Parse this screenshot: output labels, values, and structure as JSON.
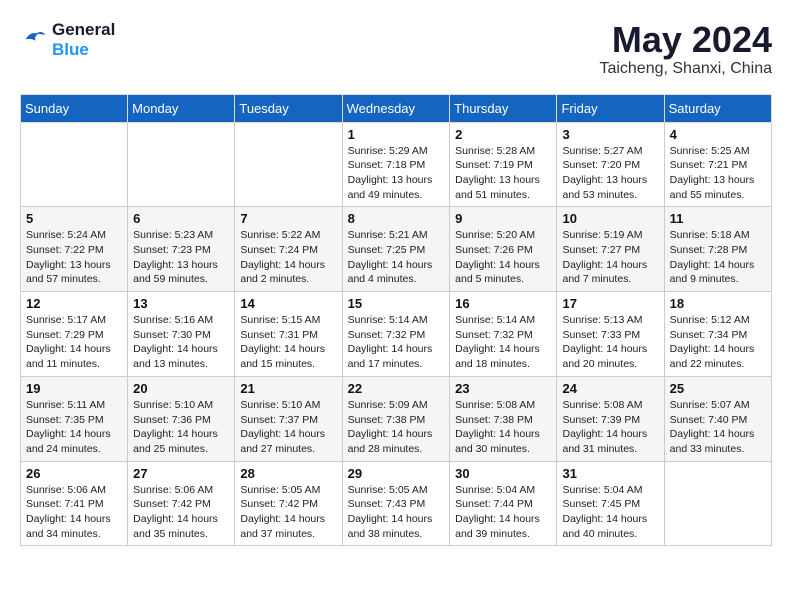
{
  "header": {
    "logo_line1": "General",
    "logo_line2": "Blue",
    "month": "May 2024",
    "location": "Taicheng, Shanxi, China"
  },
  "weekdays": [
    "Sunday",
    "Monday",
    "Tuesday",
    "Wednesday",
    "Thursday",
    "Friday",
    "Saturday"
  ],
  "weeks": [
    [
      {
        "day": "",
        "info": ""
      },
      {
        "day": "",
        "info": ""
      },
      {
        "day": "",
        "info": ""
      },
      {
        "day": "1",
        "info": "Sunrise: 5:29 AM\nSunset: 7:18 PM\nDaylight: 13 hours\nand 49 minutes."
      },
      {
        "day": "2",
        "info": "Sunrise: 5:28 AM\nSunset: 7:19 PM\nDaylight: 13 hours\nand 51 minutes."
      },
      {
        "day": "3",
        "info": "Sunrise: 5:27 AM\nSunset: 7:20 PM\nDaylight: 13 hours\nand 53 minutes."
      },
      {
        "day": "4",
        "info": "Sunrise: 5:25 AM\nSunset: 7:21 PM\nDaylight: 13 hours\nand 55 minutes."
      }
    ],
    [
      {
        "day": "5",
        "info": "Sunrise: 5:24 AM\nSunset: 7:22 PM\nDaylight: 13 hours\nand 57 minutes."
      },
      {
        "day": "6",
        "info": "Sunrise: 5:23 AM\nSunset: 7:23 PM\nDaylight: 13 hours\nand 59 minutes."
      },
      {
        "day": "7",
        "info": "Sunrise: 5:22 AM\nSunset: 7:24 PM\nDaylight: 14 hours\nand 2 minutes."
      },
      {
        "day": "8",
        "info": "Sunrise: 5:21 AM\nSunset: 7:25 PM\nDaylight: 14 hours\nand 4 minutes."
      },
      {
        "day": "9",
        "info": "Sunrise: 5:20 AM\nSunset: 7:26 PM\nDaylight: 14 hours\nand 5 minutes."
      },
      {
        "day": "10",
        "info": "Sunrise: 5:19 AM\nSunset: 7:27 PM\nDaylight: 14 hours\nand 7 minutes."
      },
      {
        "day": "11",
        "info": "Sunrise: 5:18 AM\nSunset: 7:28 PM\nDaylight: 14 hours\nand 9 minutes."
      }
    ],
    [
      {
        "day": "12",
        "info": "Sunrise: 5:17 AM\nSunset: 7:29 PM\nDaylight: 14 hours\nand 11 minutes."
      },
      {
        "day": "13",
        "info": "Sunrise: 5:16 AM\nSunset: 7:30 PM\nDaylight: 14 hours\nand 13 minutes."
      },
      {
        "day": "14",
        "info": "Sunrise: 5:15 AM\nSunset: 7:31 PM\nDaylight: 14 hours\nand 15 minutes."
      },
      {
        "day": "15",
        "info": "Sunrise: 5:14 AM\nSunset: 7:32 PM\nDaylight: 14 hours\nand 17 minutes."
      },
      {
        "day": "16",
        "info": "Sunrise: 5:14 AM\nSunset: 7:32 PM\nDaylight: 14 hours\nand 18 minutes."
      },
      {
        "day": "17",
        "info": "Sunrise: 5:13 AM\nSunset: 7:33 PM\nDaylight: 14 hours\nand 20 minutes."
      },
      {
        "day": "18",
        "info": "Sunrise: 5:12 AM\nSunset: 7:34 PM\nDaylight: 14 hours\nand 22 minutes."
      }
    ],
    [
      {
        "day": "19",
        "info": "Sunrise: 5:11 AM\nSunset: 7:35 PM\nDaylight: 14 hours\nand 24 minutes."
      },
      {
        "day": "20",
        "info": "Sunrise: 5:10 AM\nSunset: 7:36 PM\nDaylight: 14 hours\nand 25 minutes."
      },
      {
        "day": "21",
        "info": "Sunrise: 5:10 AM\nSunset: 7:37 PM\nDaylight: 14 hours\nand 27 minutes."
      },
      {
        "day": "22",
        "info": "Sunrise: 5:09 AM\nSunset: 7:38 PM\nDaylight: 14 hours\nand 28 minutes."
      },
      {
        "day": "23",
        "info": "Sunrise: 5:08 AM\nSunset: 7:38 PM\nDaylight: 14 hours\nand 30 minutes."
      },
      {
        "day": "24",
        "info": "Sunrise: 5:08 AM\nSunset: 7:39 PM\nDaylight: 14 hours\nand 31 minutes."
      },
      {
        "day": "25",
        "info": "Sunrise: 5:07 AM\nSunset: 7:40 PM\nDaylight: 14 hours\nand 33 minutes."
      }
    ],
    [
      {
        "day": "26",
        "info": "Sunrise: 5:06 AM\nSunset: 7:41 PM\nDaylight: 14 hours\nand 34 minutes."
      },
      {
        "day": "27",
        "info": "Sunrise: 5:06 AM\nSunset: 7:42 PM\nDaylight: 14 hours\nand 35 minutes."
      },
      {
        "day": "28",
        "info": "Sunrise: 5:05 AM\nSunset: 7:42 PM\nDaylight: 14 hours\nand 37 minutes."
      },
      {
        "day": "29",
        "info": "Sunrise: 5:05 AM\nSunset: 7:43 PM\nDaylight: 14 hours\nand 38 minutes."
      },
      {
        "day": "30",
        "info": "Sunrise: 5:04 AM\nSunset: 7:44 PM\nDaylight: 14 hours\nand 39 minutes."
      },
      {
        "day": "31",
        "info": "Sunrise: 5:04 AM\nSunset: 7:45 PM\nDaylight: 14 hours\nand 40 minutes."
      },
      {
        "day": "",
        "info": ""
      }
    ]
  ]
}
